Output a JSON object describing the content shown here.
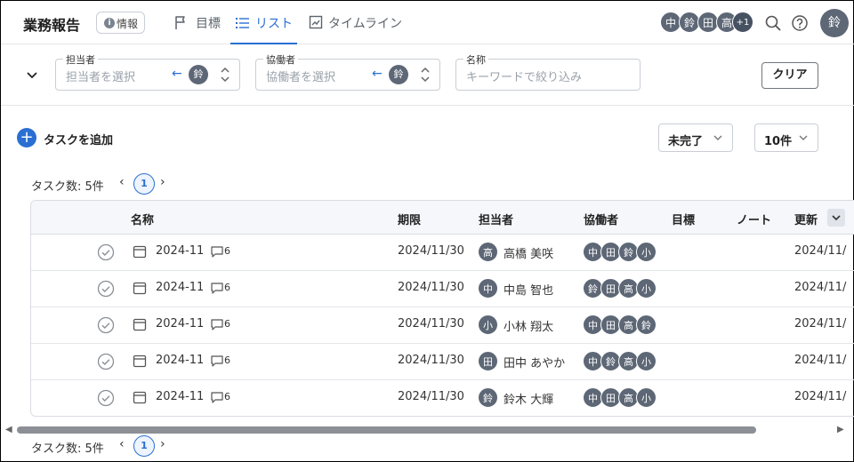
{
  "app": {
    "title": "業務報告",
    "info_label": "情報",
    "info_icon": "i"
  },
  "tabs": [
    {
      "label": "目標",
      "icon": "flag-icon",
      "active": false
    },
    {
      "label": "リスト",
      "icon": "list-icon",
      "active": true
    },
    {
      "label": "タイムライン",
      "icon": "timeline-icon",
      "active": false
    }
  ],
  "header_members": [
    "中",
    "鈴",
    "田",
    "高"
  ],
  "header_more": "+1",
  "current_user": "鈴",
  "filters": {
    "assignee": {
      "label": "担当者",
      "placeholder": "担当者を選択",
      "avatar": "鈴"
    },
    "collaborator": {
      "label": "協働者",
      "placeholder": "協働者を選択",
      "avatar": "鈴"
    },
    "name": {
      "label": "名称",
      "placeholder": "キーワードで絞り込み"
    },
    "clear_label": "クリア"
  },
  "toolbar": {
    "add_label": "タスクを追加",
    "status_select": "未完了",
    "page_size_select": "10件"
  },
  "pager": {
    "count_label": "タスク数: 5件",
    "current_page": "1"
  },
  "table": {
    "columns": {
      "name": "名称",
      "due": "期限",
      "assignee": "担当者",
      "collaborators": "協働者",
      "goal": "目標",
      "note": "ノート",
      "updated": "更新"
    },
    "rows": [
      {
        "name": "2024-11",
        "comments": "6",
        "due": "2024/11/30",
        "assignee_avatar": "高",
        "assignee": "高橋 美咲",
        "collaborators": [
          "中",
          "田",
          "鈴",
          "小"
        ],
        "goal": "",
        "note": "",
        "updated": "2024/11/"
      },
      {
        "name": "2024-11",
        "comments": "6",
        "due": "2024/11/30",
        "assignee_avatar": "中",
        "assignee": "中島 智也",
        "collaborators": [
          "鈴",
          "田",
          "高",
          "小"
        ],
        "goal": "",
        "note": "",
        "updated": "2024/11/"
      },
      {
        "name": "2024-11",
        "comments": "6",
        "due": "2024/11/30",
        "assignee_avatar": "小",
        "assignee": "小林 翔太",
        "collaborators": [
          "中",
          "田",
          "高",
          "鈴"
        ],
        "goal": "",
        "note": "",
        "updated": "2024/11/"
      },
      {
        "name": "2024-11",
        "comments": "6",
        "due": "2024/11/30",
        "assignee_avatar": "田",
        "assignee": "田中 あやか",
        "collaborators": [
          "中",
          "鈴",
          "高",
          "小"
        ],
        "goal": "",
        "note": "",
        "updated": "2024/11/"
      },
      {
        "name": "2024-11",
        "comments": "6",
        "due": "2024/11/30",
        "assignee_avatar": "鈴",
        "assignee": "鈴木 大輝",
        "collaborators": [
          "中",
          "田",
          "高",
          "小"
        ],
        "goal": "",
        "note": "",
        "updated": "2024/11/"
      }
    ]
  },
  "colors": {
    "accent": "#2a6fd1",
    "avatar": "#5d6776",
    "border": "#d9dde2"
  }
}
